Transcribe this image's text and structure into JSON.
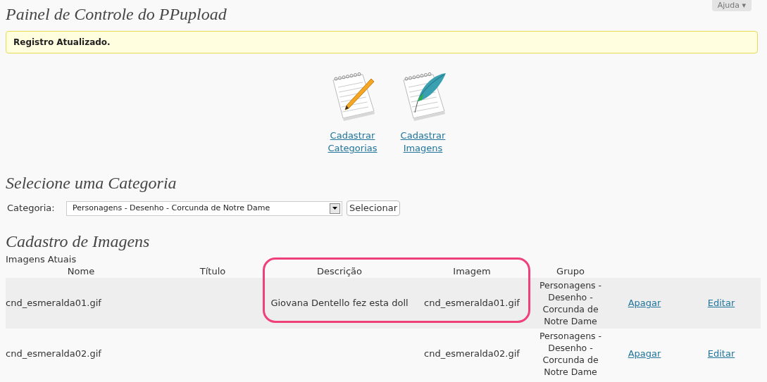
{
  "help_tab": {
    "label": "Ajuda",
    "caret": "▾"
  },
  "page_title": "Painel de Controle do PPupload",
  "notice": "Registro Atualizado.",
  "shortcuts": [
    {
      "kind": "pencil",
      "label": [
        "Cadastrar",
        "Categorias"
      ]
    },
    {
      "kind": "feather",
      "label": [
        "Cadastrar",
        "Imagens"
      ]
    }
  ],
  "select_section": {
    "title": "Selecione uma Categoria",
    "label": "Categoria:",
    "value": "Personagens - Desenho - Corcunda de Notre Dame",
    "button": "Selecionar"
  },
  "images_section": {
    "title": "Cadastro de Imagens",
    "caption": "Imagens Atuais",
    "columns": [
      "Nome",
      "Título",
      "Descrição",
      "Imagem",
      "Grupo"
    ],
    "rows": [
      {
        "nome": "cnd_esmeralda01.gif",
        "titulo": "",
        "descricao": "Giovana Dentello fez esta doll",
        "imagem": "cnd_esmeralda01.gif",
        "grupo": [
          "Personagens -",
          "Desenho -",
          "Corcunda de",
          "Notre Dame"
        ],
        "delete": "Apagar",
        "edit": "Editar"
      },
      {
        "nome": "cnd_esmeralda02.gif",
        "titulo": "",
        "descricao": "",
        "imagem": "cnd_esmeralda02.gif",
        "grupo": [
          "Personagens -",
          "Desenho -",
          "Corcunda de",
          "Notre Dame"
        ],
        "delete": "Apagar",
        "edit": "Editar"
      }
    ]
  }
}
